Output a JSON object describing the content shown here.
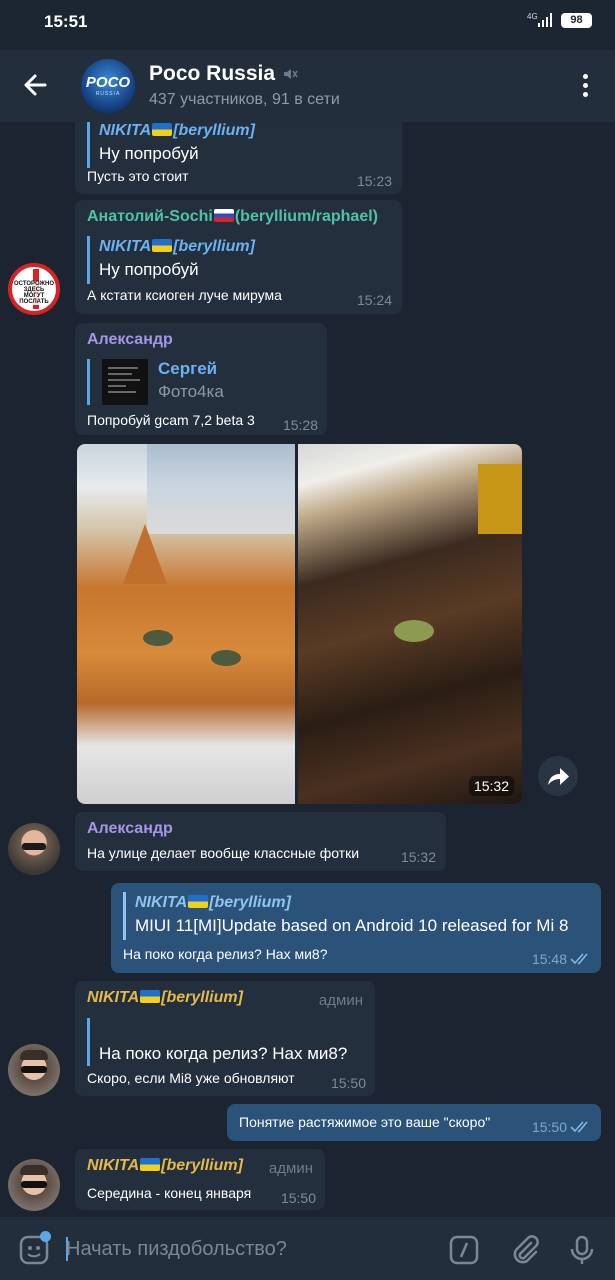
{
  "status_bar": {
    "time": "15:51",
    "network": "4G",
    "battery": "98"
  },
  "header": {
    "avatar_text": "POCO",
    "avatar_subtext": "RUSSIA",
    "title": "Poco Russia",
    "subtitle": "437 участников, 91 в сети"
  },
  "messages": [
    {
      "reply_name_pre": "NIKITA",
      "reply_name_post": "[beryllium]",
      "reply_text": "Ну попробуй",
      "text": "Пусть это стоит",
      "time": "15:23"
    },
    {
      "sender_pre": "Анатолий-Sochi",
      "sender_post": "(beryllium/raphael)",
      "reply_name_pre": "NIKITA",
      "reply_name_post": "[beryllium]",
      "reply_text": "Ну попробуй",
      "text": "А кстати ксиоген луче мирума",
      "time": "15:24",
      "avatar_text": "ОСТОРОЖНО ЗДЕСЬ МОГУТ ПОСЛАТЬ"
    },
    {
      "sender": "Александр",
      "reply_name": "Сергей",
      "reply_text": "Фото4ка",
      "text": "Попробуй gcam 7,2 beta 3",
      "time": "15:28"
    },
    {
      "type": "photo_album",
      "time": "15:32"
    },
    {
      "sender": "Александр",
      "text": "На улице делает вообще классные фотки",
      "time": "15:32"
    },
    {
      "outgoing": true,
      "reply_name_pre": "NIKITA",
      "reply_name_post": "[beryllium]",
      "reply_text": "MIUI 11[MI]Update based on Android 10  released for Mi 8",
      "text": "На поко когда релиз? Нах ми8?",
      "time": "15:48"
    },
    {
      "sender_pre": "NIKITA",
      "sender_post": "[beryllium]",
      "badge": "админ",
      "reply_text": "На поко когда релиз? Нах ми8?",
      "text": "Скоро, если Mi8 уже обновляют",
      "time": "15:50"
    },
    {
      "outgoing": true,
      "text": "Понятие растяжимое это ваше \"скоро\"",
      "time": "15:50"
    },
    {
      "sender_pre": "NIKITA",
      "sender_post": "[beryllium]",
      "badge": "админ",
      "text": "Середина - конец января",
      "time": "15:50"
    }
  ],
  "input": {
    "placeholder": "Начать пиздобольство?"
  },
  "colors": {
    "background": "#1b2430",
    "bubble_in": "#242f3d",
    "bubble_out": "#2b5278",
    "accent": "#5ea7e6",
    "name_anatoly": "#4fc3a1",
    "name_alexandr": "#a695e7",
    "name_nikita": "#e5b94a"
  },
  "icons": [
    "back-arrow-icon",
    "mute-icon",
    "more-vertical-icon",
    "forward-icon",
    "read-checks-icon",
    "sticker-icon",
    "bot-command-icon",
    "attach-icon",
    "microphone-icon"
  ]
}
